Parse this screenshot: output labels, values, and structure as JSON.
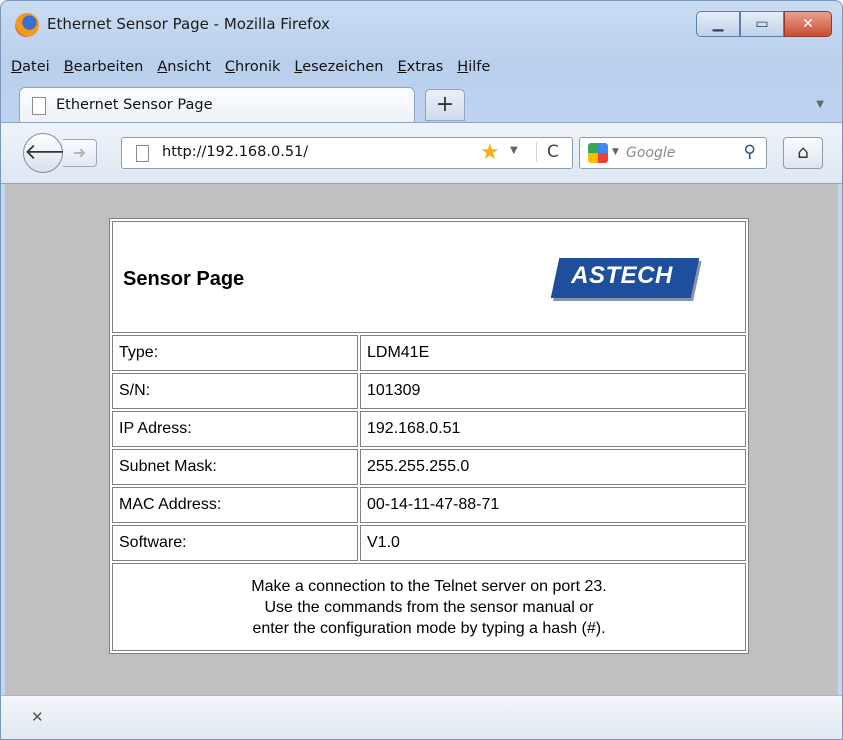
{
  "window": {
    "title": "Ethernet Sensor Page - Mozilla Firefox"
  },
  "menu": [
    "Datei",
    "Bearbeiten",
    "Ansicht",
    "Chronik",
    "Lesezeichen",
    "Extras",
    "Hilfe"
  ],
  "tab": {
    "label": "Ethernet Sensor Page"
  },
  "nav": {
    "url": "http://192.168.0.51/",
    "search_placeholder": "Google"
  },
  "page": {
    "title": "Sensor Page",
    "logo": "ASTECH",
    "rows": [
      {
        "label": "Type:",
        "value": "LDM41E"
      },
      {
        "label": "S/N:",
        "value": "101309"
      },
      {
        "label": "IP Adress:",
        "value": "192.168.0.51"
      },
      {
        "label": "Subnet Mask:",
        "value": "255.255.255.0"
      },
      {
        "label": "MAC Address:",
        "value": "00-14-11-47-88-71"
      },
      {
        "label": "Software:",
        "value": "V1.0"
      }
    ],
    "note": [
      "Make a connection to the Telnet server on port 23.",
      "Use the commands from the sensor manual or",
      "enter the configuration mode by typing a hash (#)."
    ]
  },
  "icons": {
    "app": "firefox-icon",
    "minimize": "minimize-icon",
    "maximize": "maximize-icon",
    "close": "close-icon",
    "back": "back-arrow-icon",
    "forward": "forward-arrow-icon",
    "bookmark": "star-icon",
    "reload": "reload-icon",
    "search": "magnifier-icon",
    "home": "home-icon"
  }
}
